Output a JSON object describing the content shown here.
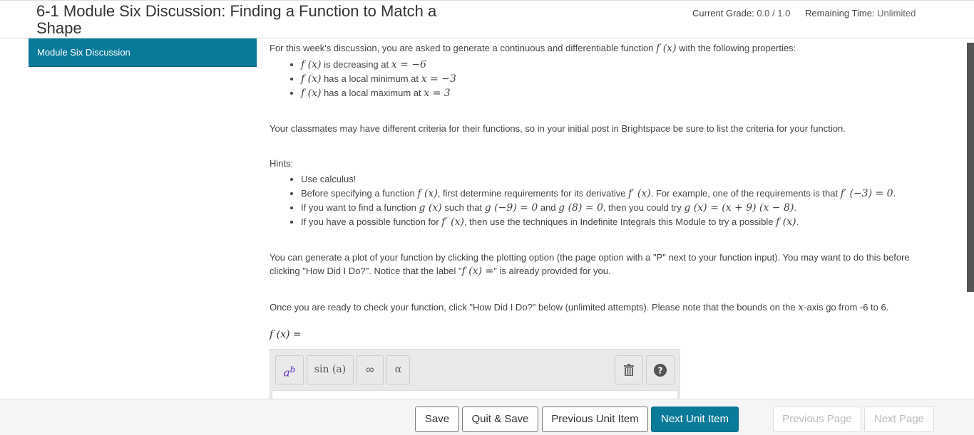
{
  "header": {
    "title": "6-1 Module Six Discussion: Finding a Function to Match a Shape",
    "grade_label": "Current Grade:",
    "grade_value": "0.0 / 1.0",
    "remaining_label": "Remaining Time:",
    "remaining_value": "Unlimited"
  },
  "sidebar": {
    "items": [
      {
        "label": "Module Six Discussion",
        "active": true
      }
    ]
  },
  "content": {
    "intro_pre": "For this week's discussion, you are asked to generate a continuous and differentiable function ",
    "intro_fx": "f (x)",
    "intro_post": " with the following properties:",
    "properties": [
      {
        "fx": "f (x)",
        "text": " is decreasing at ",
        "math": "x = −6"
      },
      {
        "fx": "f (x)",
        "text": " has a local minimum at ",
        "math": "x = −3"
      },
      {
        "fx": "f (x)",
        "text": " has a local maximum at ",
        "math": "x = 3"
      }
    ],
    "classmates_text": "Your classmates may have different criteria for their functions, so in your initial post in Brightspace be sure to list the criteria for your function.",
    "hints_label": "Hints:",
    "hint1": "Use calculus!",
    "hint2_a": "Before specifying a function ",
    "hint2_fx": "f (x)",
    "hint2_b": ", first determine requirements for its derivative ",
    "hint2_fpx": "f′ (x)",
    "hint2_c": ". For example, one of the requirements is that ",
    "hint2_req": "f′ (−3) = 0",
    "hint2_d": ".",
    "hint3_a": "If you want to find a function ",
    "hint3_gx": "g (x)",
    "hint3_b": " such that ",
    "hint3_g9": "g (−9) = 0",
    "hint3_c": " and ",
    "hint3_g8": "g (8) = 0",
    "hint3_d": ", then you could try  ",
    "hint3_try": "g (x) = (x + 9) (x − 8)",
    "hint3_e": ".",
    "hint4_a": "If you have a possible function for ",
    "hint4_fpx": "f′ (x)",
    "hint4_b": ", then use the techniques in Indefinite Integrals this Module to try a possible ",
    "hint4_fx": "f (x)",
    "hint4_c": ".",
    "plot_a": "You can generate a plot of your function by clicking the plotting option (the page option with a \"P\" next to your function input). You may want to do this before clicking \"How Did I Do?\". Notice that the label \"",
    "plot_fx": "f (x) =",
    "plot_b": "\" is already provided for you.",
    "check_a": "Once you are ready to check your function, click \"How Did I Do?\" below (unlimited attempts). Please note that the bounds on the ",
    "check_x": "x",
    "check_b": "-axis go from -6 to 6."
  },
  "answer": {
    "label": "f (x) =",
    "toolbar": {
      "power_base": "a",
      "power_exp": "b",
      "sin_label": "sin (a)",
      "infinity_label": "∞",
      "alpha_label": "α"
    }
  },
  "footer": {
    "save": "Save",
    "quit_save": "Quit & Save",
    "previous_unit": "Previous Unit Item",
    "next_unit": "Next Unit Item",
    "previous_page": "Previous Page",
    "next_page": "Next Page"
  },
  "colors": {
    "accent": "#0a7a9b",
    "power_icon": "#5a2ab4"
  },
  "icons": [
    "trash-icon",
    "help-icon"
  ]
}
